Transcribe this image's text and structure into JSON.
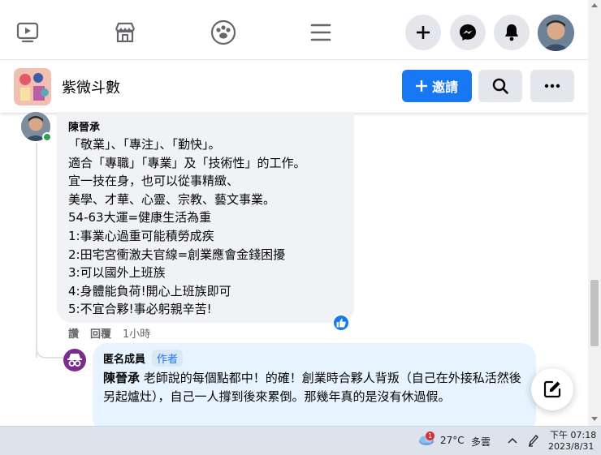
{
  "topbar": {
    "icons": [
      "video-icon",
      "marketplace-icon",
      "groups-icon",
      "menu-icon",
      "create-plus-icon",
      "messenger-icon",
      "notifications-bell-icon",
      "profile-avatar"
    ]
  },
  "group": {
    "name": "紫微斗數",
    "invite_label": "邀請"
  },
  "comment": {
    "author": "陳晉承",
    "lines": [
      "「敬業」、「專注」、「勤快」。",
      "適合「專職」「專業」及「技術性」的工作。",
      "宜一技在身，也可以從事精緻、",
      "美學、才華、心靈、宗教、藝文事業。",
      "54-63大運=健康生活為重",
      "1:事業心過重可能積勞成疾",
      "2:田宅宮衝激夫官線=創業應會金錢困擾",
      "3:可以國外上班族",
      "4:身體能負荷!開心上班族即可",
      "5:不宜合夥!事必躬親辛苦!"
    ],
    "actions": {
      "like": "讚",
      "reply": "回覆",
      "time": "1小時"
    }
  },
  "reply": {
    "author": "匿名成員",
    "tag": "作者",
    "mention": "陳晉承",
    "text": " 老師說的每個點都中！的確！創業時合夥人背叛（自己在外接私活然後另起爐灶），自己一人撐到後來累倒。那幾年真的是沒有休過假。"
  },
  "taskbar": {
    "weather_badge": "1",
    "temperature": "27°C",
    "weather": "多雲",
    "time": "下午 07:18",
    "date": "2023/8/31"
  },
  "colors": {
    "accent": "#1877f2",
    "bubble": "#f0f2f5",
    "reply_bubble": "#e7f3ff",
    "online": "#31a24c"
  }
}
